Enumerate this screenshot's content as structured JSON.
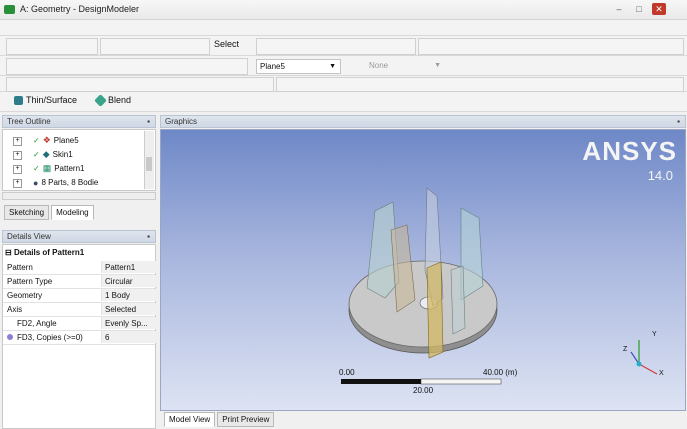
{
  "window": {
    "title": "A: Geometry - DesignModeler"
  },
  "toolbar": {
    "select_label": "Select",
    "plane_combo": "Plane5",
    "sketch_combo": "None"
  },
  "features": {
    "thin_surface": "Thin/Surface",
    "blend": "Blend"
  },
  "tree_outline": {
    "header": "Tree Outline",
    "items": [
      {
        "label": "Plane5"
      },
      {
        "label": "Skin1"
      },
      {
        "label": "Pattern1"
      },
      {
        "label": "8 Parts, 8 Bodie"
      }
    ],
    "tabs": [
      "Sketching",
      "Modeling"
    ]
  },
  "details_view": {
    "header": "Details View",
    "group_title": "Details of Pattern1",
    "rows": [
      {
        "key": "Pattern",
        "value": "Pattern1"
      },
      {
        "key": "Pattern Type",
        "value": "Circular"
      },
      {
        "key": "Geometry",
        "value": "1 Body"
      },
      {
        "key": "Axis",
        "value": "Selected"
      },
      {
        "key": "FD2, Angle",
        "value": "Evenly Sp..."
      },
      {
        "key": "FD3, Copies (>=0)",
        "value": "6"
      }
    ]
  },
  "graphics": {
    "header": "Graphics",
    "logo": "ANSYS",
    "version": "14.0",
    "scale": {
      "start": "0.00",
      "end": "40.00 (m)",
      "mid": "20.00"
    },
    "axes": [
      "X",
      "Y",
      "Z"
    ],
    "bottom_tabs": [
      "Model View",
      "Print Preview"
    ]
  },
  "colors": {
    "viewport_top": "#6e88c7",
    "viewport_bottom": "#dde3f3",
    "logo_accent": "#e9c44a"
  }
}
